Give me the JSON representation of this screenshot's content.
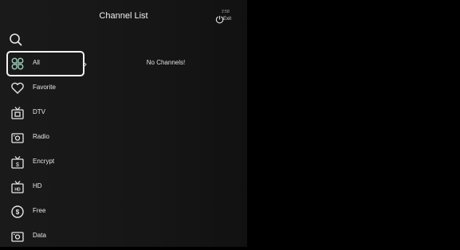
{
  "header": {
    "title": "Channel List",
    "exit_top": "2:58",
    "exit_label": "Exit"
  },
  "search": {
    "icon": "search-icon"
  },
  "menu": {
    "selected": "All",
    "items": [
      {
        "label": "All",
        "icon": "grid-icon"
      },
      {
        "label": "Favorite",
        "icon": "heart-icon"
      },
      {
        "label": "DTV",
        "icon": "tv-icon"
      },
      {
        "label": "Radio",
        "icon": "radio-icon"
      },
      {
        "label": "Encrypt",
        "icon": "encrypt-icon"
      },
      {
        "label": "HD",
        "icon": "hd-icon"
      },
      {
        "label": "Free",
        "icon": "free-icon"
      },
      {
        "label": "Data",
        "icon": "data-icon"
      }
    ]
  },
  "content": {
    "empty_message": "No Channels!"
  },
  "colors": {
    "background": "#000000",
    "panel": "#171717",
    "text": "#e8e8e8",
    "selection": "#f2f2f2"
  }
}
